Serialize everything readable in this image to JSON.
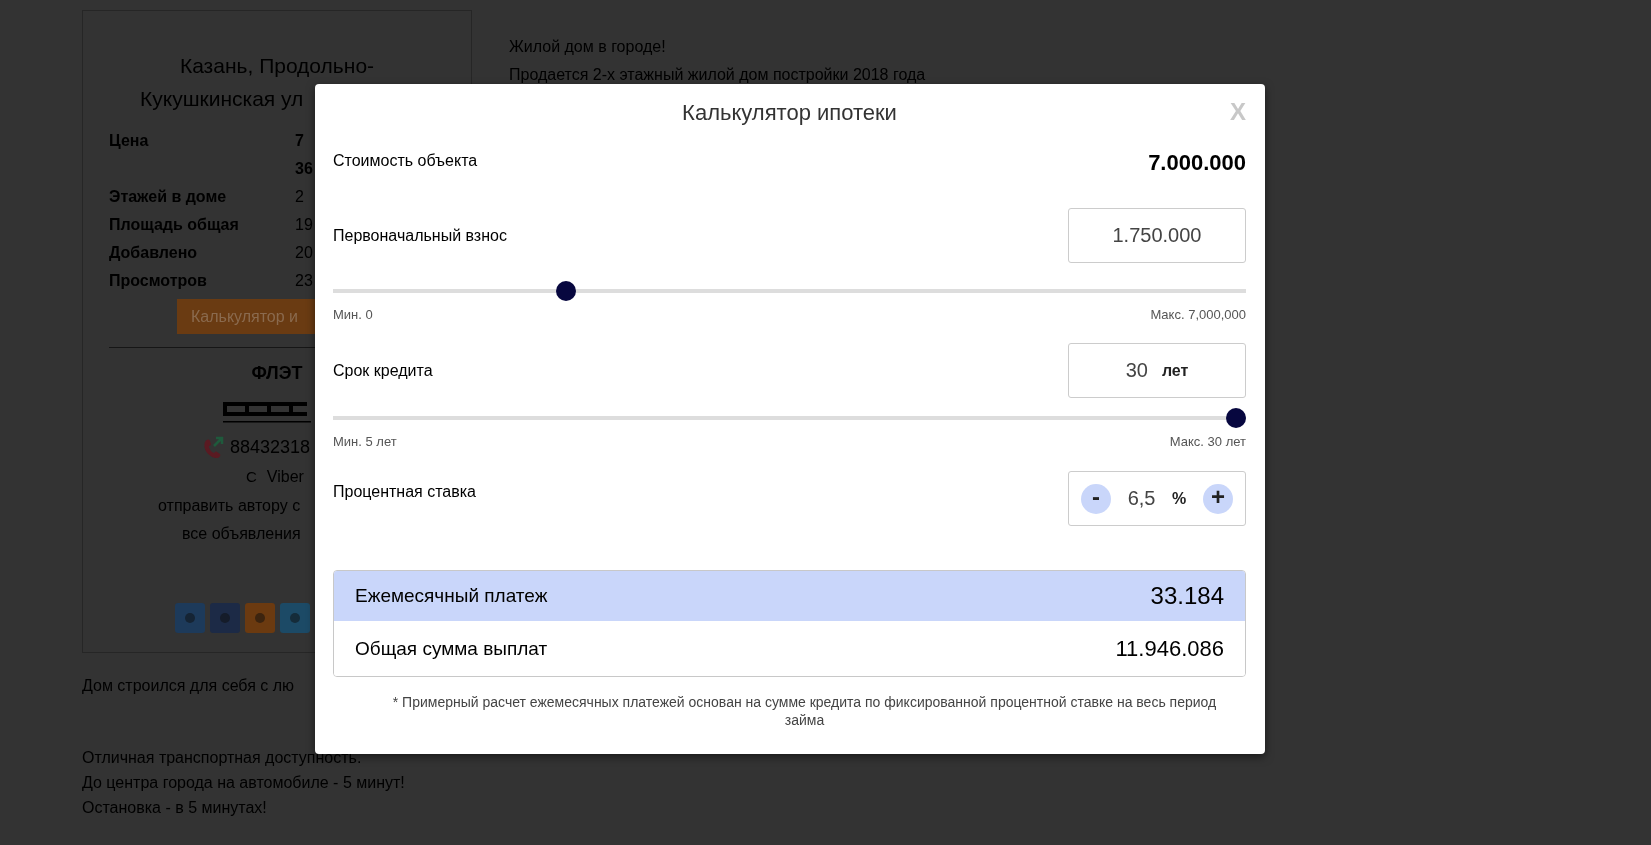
{
  "listing_card": {
    "title_lines": [
      "Казань, Продольно-",
      "Кукушкинская ул"
    ],
    "details": [
      {
        "label": "Цена",
        "value": "7"
      },
      {
        "value": "36"
      },
      {
        "label": "Этажей в доме",
        "value": "2"
      },
      {
        "label": "Площадь общая",
        "value": "19"
      },
      {
        "label": "Добавлено",
        "value": "20"
      },
      {
        "label": "Просмотров",
        "value": "23"
      }
    ],
    "calculator_button": "Калькулятор и",
    "agency_name": "ФЛЭТ",
    "phone": "88432318",
    "contact_prefix": "С",
    "contact_messenger": "Viber",
    "links": [
      "отправить автору с",
      "все объявления"
    ]
  },
  "description_top": [
    "Жилой дом в городе!",
    "Продается 2-х этажный жилой дом постройки 2018 года"
  ],
  "description_bottom": [
    [
      "Дом строился для себя с лю"
    ],
    [
      "Отличная транспортная доступность.",
      "До центра города на автомобиле - 5 минут!",
      "Остановка - в 5 минутах!"
    ]
  ],
  "mortgage_calculator": {
    "title": "Калькулятор ипотеки",
    "close": "X",
    "property_cost": {
      "label": "Стоимость объекта",
      "value": "7.000.000"
    },
    "down_payment": {
      "label": "Первоначальный взнос",
      "value": "1.750.000",
      "level": 0.25,
      "min_label": "Мин. 0",
      "max_label": "Макс. 7,000,000"
    },
    "term": {
      "label": "Срок кредита",
      "value": "30",
      "unit": "лет",
      "level": 1,
      "min_label": "Мин. 5 лет",
      "max_label": "Макс. 30 лет"
    },
    "rate": {
      "label": "Процентная ставка",
      "value": "6,5",
      "unit": "%",
      "decrement": "-",
      "increment": "+"
    },
    "results": [
      {
        "label": "Ежемесячный платеж",
        "value": "33.184",
        "highlighted": true
      },
      {
        "label": "Общая сумма выплат",
        "value": "11.946.086",
        "highlighted": false
      }
    ],
    "footnote": "* Примерный расчет ежемесячных платежей основан на сумме кредита по фиксированной процентной ставке на весь период займа"
  }
}
